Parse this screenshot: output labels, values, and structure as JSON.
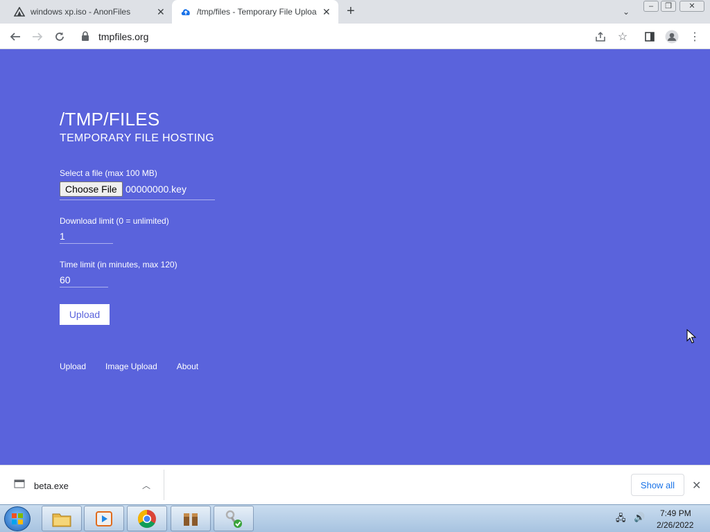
{
  "browser": {
    "tabs": [
      {
        "title": "windows xp.iso - AnonFiles",
        "favicon": "anonfiles-icon"
      },
      {
        "title": "/tmp/files - Temporary File Uploa",
        "favicon": "cloud-upload-icon",
        "active": true
      }
    ],
    "url": "tmpfiles.org"
  },
  "page": {
    "title": "/TMP/FILES",
    "subtitle": "TEMPORARY FILE HOSTING",
    "file_label": "Select a file (max 100 MB)",
    "choose_file_label": "Choose File",
    "file_name": "00000000.key",
    "download_limit_label": "Download limit (0 = unlimited)",
    "download_limit_value": "1",
    "time_limit_label": "Time limit (in minutes, max 120)",
    "time_limit_value": "60",
    "upload_label": "Upload",
    "footer_links": [
      "Upload",
      "Image Upload",
      "About"
    ],
    "background_color": "#5a63dc"
  },
  "download_bar": {
    "file_name": "beta.exe",
    "show_all_label": "Show all"
  },
  "taskbar": {
    "time": "7:49 PM",
    "date": "2/26/2022",
    "items": [
      "explorer-icon",
      "media-player-icon",
      "chrome-icon",
      "archive-icon",
      "keys-icon"
    ]
  }
}
